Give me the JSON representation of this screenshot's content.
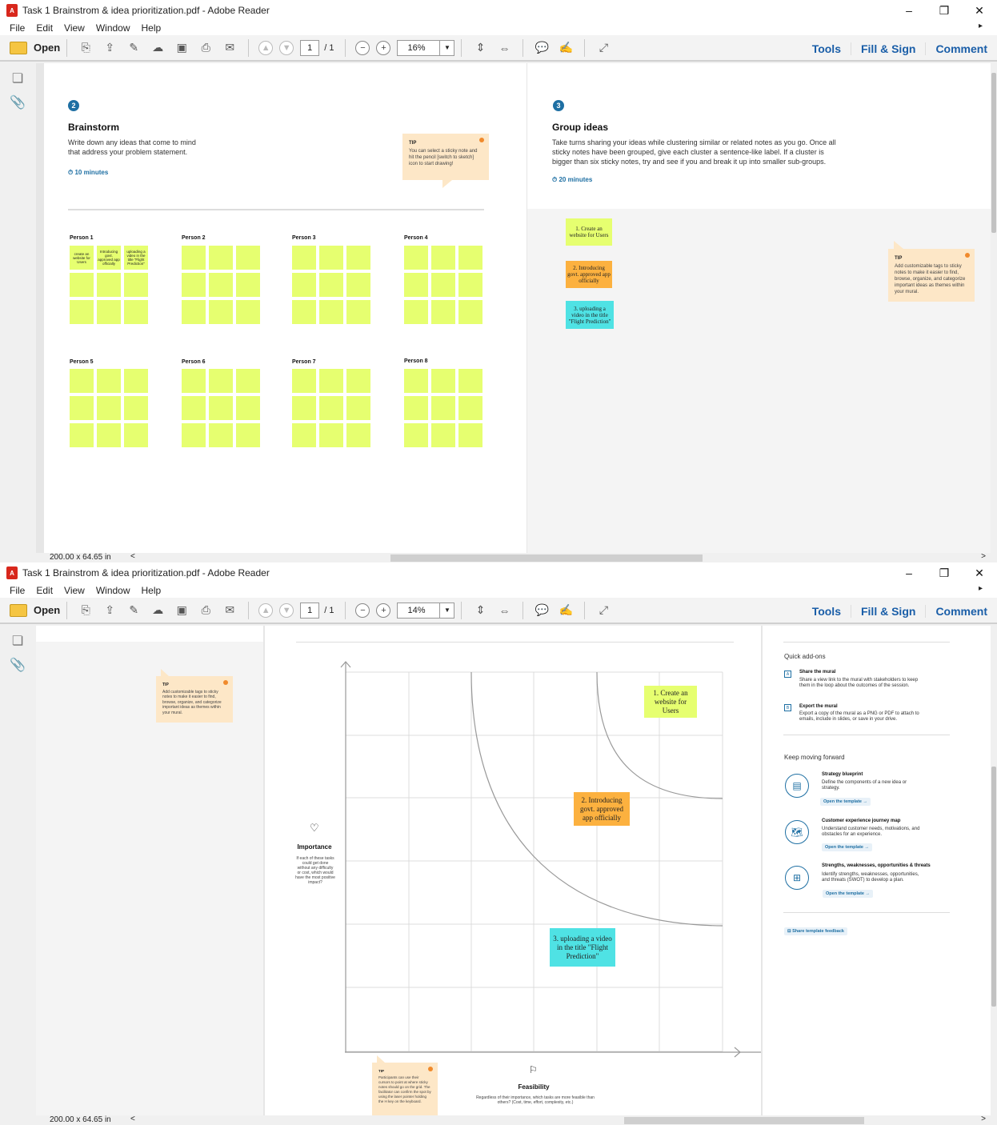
{
  "app": {
    "title": "Task 1 Brainstrom & idea prioritization.pdf - Adobe Reader",
    "menu": [
      "File",
      "Edit",
      "View",
      "Window",
      "Help"
    ],
    "open_label": "Open",
    "page_current": "1",
    "page_total": "/ 1",
    "tools": "Tools",
    "fill_sign": "Fill & Sign",
    "comment": "Comment",
    "status_size": "200.00 x 64.65 in"
  },
  "windows": [
    {
      "zoom": "16%"
    },
    {
      "zoom": "14%"
    }
  ],
  "brainstorm": {
    "step": "2",
    "title": "Brainstorm",
    "desc1": "Write down any ideas that come to mind",
    "desc2": "that address your problem statement.",
    "timer": "10 minutes",
    "tip_label": "TIP",
    "tip_text": "You can select a sticky note and hit the pencil [switch to sketch] icon to start drawing!",
    "persons": [
      "Person 1",
      "Person 2",
      "Person 3",
      "Person 4",
      "Person 5",
      "Person 6",
      "Person 7",
      "Person 8"
    ],
    "person1_notes": [
      "create an website for Users",
      "Introducing govt. approved app officially",
      "uploading a video in the title \"Flight Prediction\""
    ]
  },
  "group": {
    "step": "3",
    "title": "Group ideas",
    "desc1": "Take turns sharing your ideas while clustering similar or related notes as you go. Once all",
    "desc2": "sticky notes have been grouped, give each cluster a sentence-like label. If a cluster is",
    "desc3": "bigger than six sticky notes, try and see if you and break it up into smaller sub-groups.",
    "timer": "20 minutes",
    "notes": [
      {
        "text": "1. Create an website for Users",
        "color": "#e6ff70"
      },
      {
        "text": "2. Introducing govt. approved app officially",
        "color": "#fcb13f"
      },
      {
        "text": "3. uploading a video in the title \"Flight Prediction\"",
        "color": "#4fe2e4"
      }
    ],
    "tip_label": "TIP",
    "tip_text": "Add customizable tags to sticky notes to make it easier to find, browse, organize, and categorize important ideas as themes within your mural."
  },
  "prioritize": {
    "tip_label": "TIP",
    "tip_text": "Add customizable tags to sticky notes to make it easier to find, browse, organize, and categorize important ideas as themes within your mural.",
    "importance_title": "Importance",
    "importance_desc": "If each of these tasks could get done without any difficulty or cost, which would have the most positive impact?",
    "feasibility_title": "Feasibility",
    "feasibility_desc": "Regardless of their importance, which tasks are more feasible than others? (Cost, time, effort, complexity, etc.)",
    "bottom_tip_label": "TIP",
    "bottom_tip_text": "Participants can use their cursors to point at where sticky notes should go on the grid. The facilitator can confirm the spot by using the laser pointer holding the H key on the keyboard.",
    "notes": [
      {
        "text": "1. Create an website for Users",
        "color": "#e6ff70"
      },
      {
        "text": "2. Introducing govt. approved app officially",
        "color": "#fcb13f"
      },
      {
        "text": "3. uploading a video in the title \"Flight Prediction\"",
        "color": "#4fe2e4"
      }
    ]
  },
  "sidebar": {
    "quick_addons": "Quick add-ons",
    "share_title": "Share the mural",
    "share_desc1": "Share a view link to the mural with stakeholders to keep",
    "share_desc2": "them in the loop about the outcomes of the session.",
    "export_title": "Export the mural",
    "export_desc1": "Export a copy of the mural as a PNG or PDF to attach to",
    "export_desc2": "emails, include in slides, or save in your drive.",
    "keep_moving": "Keep moving forward",
    "t1_title": "Strategy blueprint",
    "t1_desc1": "Define the components of a new idea or",
    "t1_desc2": "strategy.",
    "t2_title": "Customer experience journey map",
    "t2_desc1": "Understand customer needs, motivations, and",
    "t2_desc2": "obstacles for an experience.",
    "t3_title": "Strengths, weaknesses, opportunities & threats",
    "t3_desc1": "Identify strengths, weaknesses, opportunities,",
    "t3_desc2": "and threats (SWOT) to develop a plan.",
    "open_template": "Open the template →",
    "feedback": "Share template feedback"
  }
}
